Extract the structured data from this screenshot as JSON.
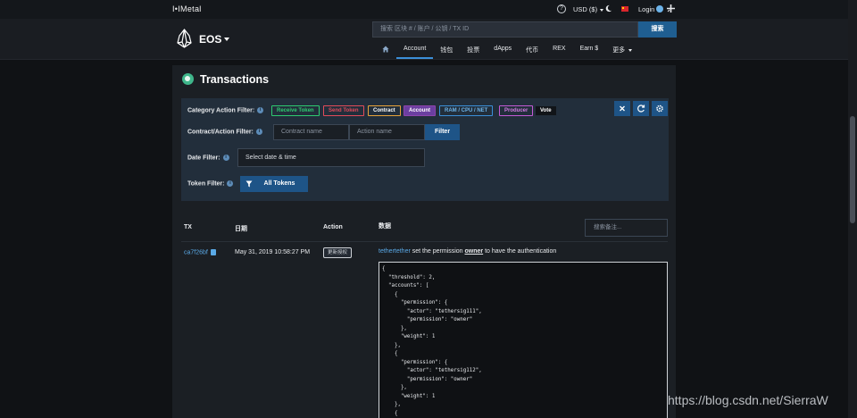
{
  "topbar": {
    "logo": "I•IMetal",
    "currency": "USD ($)",
    "login": "Login"
  },
  "header": {
    "chain": "EOS",
    "search_placeholder": "搜索 区块 # / 账户 / 公钥 / TX ID",
    "search_button": "搜索",
    "nav": [
      "Account",
      "钱包",
      "投票",
      "dApps",
      "代币",
      "REX",
      "Earn $",
      "更多"
    ]
  },
  "page": {
    "title": "Transactions"
  },
  "filters": {
    "category_label": "Category Action Filter:",
    "chips": [
      {
        "label": "Receive Token",
        "color": "#2ecc71"
      },
      {
        "label": "Send Token",
        "color": "#e24b5a"
      },
      {
        "label": "Contract",
        "color": "#e8a33a"
      },
      {
        "label": "Account",
        "color": "#8e44ad"
      },
      {
        "label": "RAM / CPU / NET",
        "color": "#3b8fd9"
      },
      {
        "label": "Producer",
        "color": "#c45ad6"
      },
      {
        "label": "Vote",
        "color": "#e8eaed"
      }
    ],
    "contract_label": "Contract/Action Filter:",
    "contract_placeholder": "Contract name",
    "action_placeholder": "Action name",
    "filter_button": "Filter",
    "date_label": "Date Filter:",
    "date_placeholder": "Select date & time",
    "token_label": "Token Filter:",
    "token_button": "All Tokens",
    "info_symbol": "i"
  },
  "table": {
    "headers": {
      "tx": "TX",
      "date": "日期",
      "action": "Action",
      "data": "数据"
    },
    "search_note_placeholder": "搜索备注...",
    "rows": [
      {
        "tx": "ca7f26bf",
        "date": "May 31, 2019 10:58:27 PM",
        "action": "更新授权",
        "account": "tethertether",
        "text_before": " set the permission ",
        "permission": "owner",
        "text_after": " to have the authentication",
        "json": "{\n  \"threshold\": 2,\n  \"accounts\": [\n    {\n      \"permission\": {\n        \"actor\": \"tethersig111\",\n        \"permission\": \"owner\"\n      },\n      \"weight\": 1\n    },\n    {\n      \"permission\": {\n        \"actor\": \"tethersig112\",\n        \"permission\": \"owner\"\n      },\n      \"weight\": 1\n    },\n    {"
      }
    ]
  },
  "watermark": "https://blog.csdn.net/SierraW"
}
